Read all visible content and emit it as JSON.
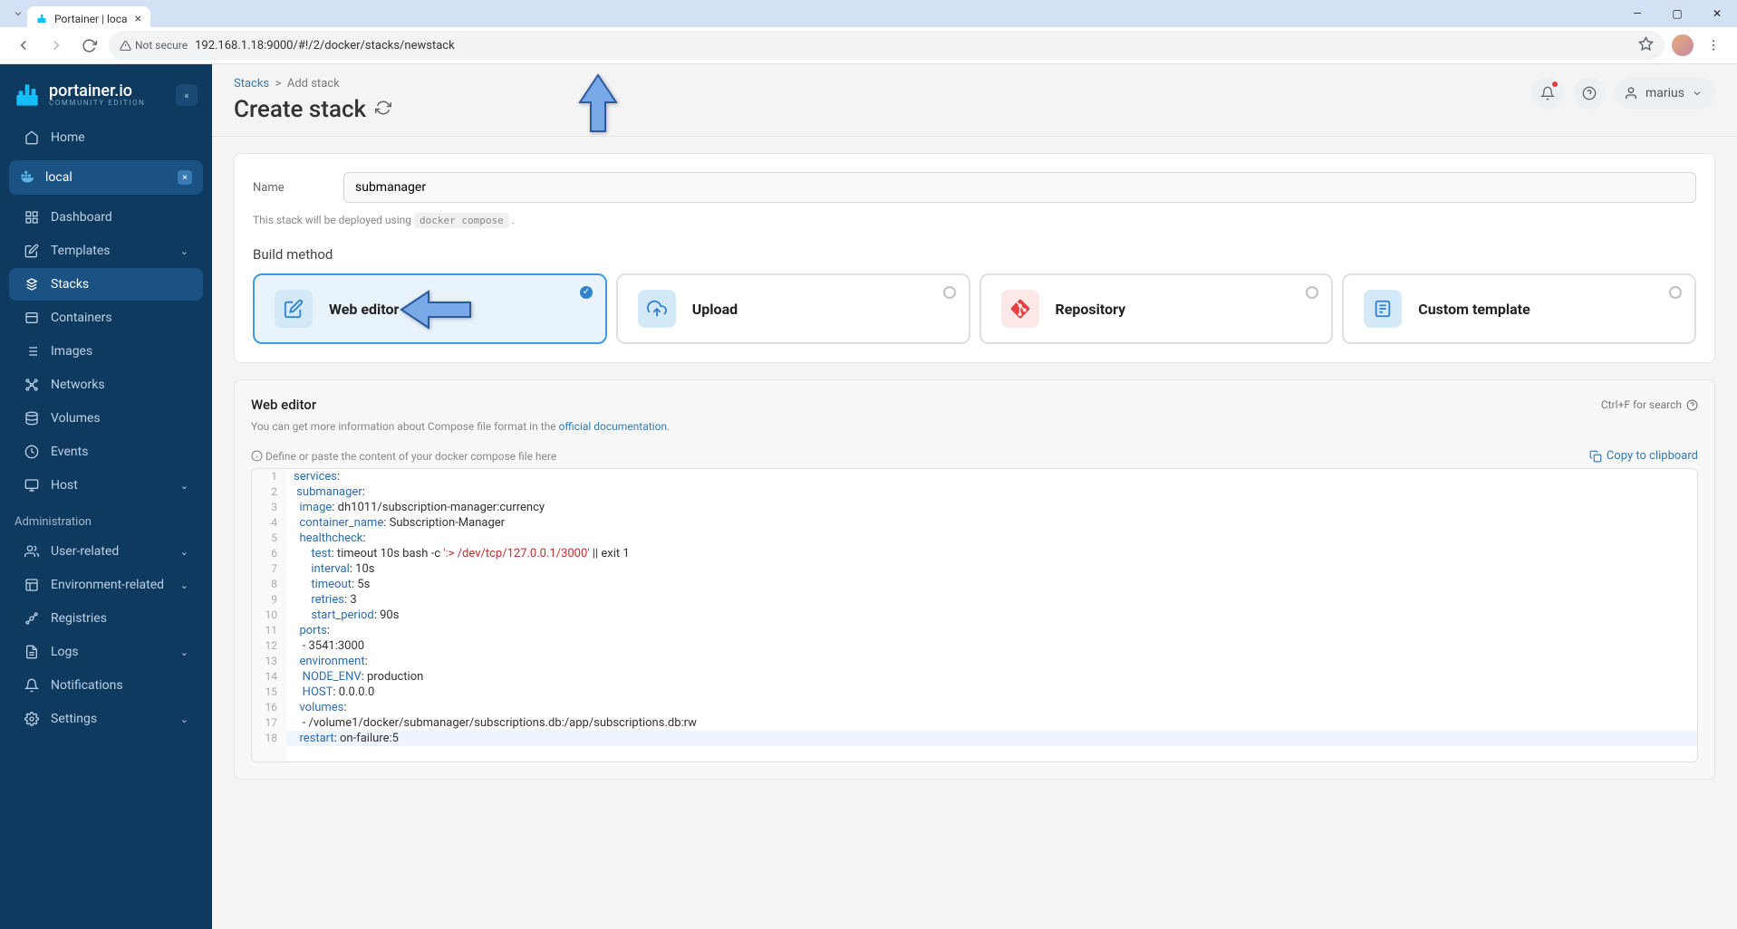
{
  "browser": {
    "tab_title": "Portainer | loca",
    "url": "192.168.1.18:9000/#!/2/docker/stacks/newstack",
    "security_label": "Not secure"
  },
  "brand": {
    "name": "portainer.io",
    "edition": "COMMUNITY EDITION"
  },
  "sidebar": {
    "home": "Home",
    "env_name": "local",
    "items": [
      {
        "label": "Dashboard",
        "icon": "dashboard"
      },
      {
        "label": "Templates",
        "icon": "templates",
        "chev": true
      },
      {
        "label": "Stacks",
        "icon": "stacks",
        "active": true
      },
      {
        "label": "Containers",
        "icon": "containers"
      },
      {
        "label": "Images",
        "icon": "images"
      },
      {
        "label": "Networks",
        "icon": "networks"
      },
      {
        "label": "Volumes",
        "icon": "volumes"
      },
      {
        "label": "Events",
        "icon": "events"
      },
      {
        "label": "Host",
        "icon": "host",
        "chev": true
      }
    ],
    "admin_header": "Administration",
    "admin_items": [
      {
        "label": "User-related",
        "chev": true
      },
      {
        "label": "Environment-related",
        "chev": true
      },
      {
        "label": "Registries"
      },
      {
        "label": "Logs",
        "chev": true
      },
      {
        "label": "Notifications"
      },
      {
        "label": "Settings",
        "chev": true
      }
    ]
  },
  "header": {
    "breadcrumb_root": "Stacks",
    "breadcrumb_leaf": "Add stack",
    "title": "Create stack",
    "user": "marius"
  },
  "form": {
    "name_label": "Name",
    "name_value": "submanager",
    "deploy_note_prefix": "This stack will be deployed using ",
    "deploy_note_cmd": "docker compose",
    "build_method_label": "Build method",
    "methods": [
      {
        "title": "Web editor"
      },
      {
        "title": "Upload"
      },
      {
        "title": "Repository"
      },
      {
        "title": "Custom template"
      }
    ]
  },
  "editor": {
    "title": "Web editor",
    "search_hint": "Ctrl+F for search",
    "info_text_prefix": "You can get more information about Compose file format in the ",
    "info_link": "official documentation",
    "placeholder_hint": "Define or paste the content of your docker compose file here",
    "copy_label": "Copy to clipboard",
    "lines": [
      [
        {
          "t": "services",
          "c": "k"
        },
        {
          "t": ":",
          "c": "p"
        }
      ],
      [
        {
          "t": " submanager",
          "c": "k"
        },
        {
          "t": ":",
          "c": "p"
        }
      ],
      [
        {
          "t": "  image",
          "c": "k"
        },
        {
          "t": ": dh1011/subscription-manager:currency",
          "c": "p"
        }
      ],
      [
        {
          "t": "  container_name",
          "c": "k"
        },
        {
          "t": ": Subscription-Manager",
          "c": "p"
        }
      ],
      [
        {
          "t": "  healthcheck",
          "c": "k"
        },
        {
          "t": ":",
          "c": "p"
        }
      ],
      [
        {
          "t": "      test",
          "c": "k"
        },
        {
          "t": ": timeout 10s bash -c ",
          "c": "p"
        },
        {
          "t": "':> /dev/tcp/127.0.0.1/3000'",
          "c": "s"
        },
        {
          "t": " || exit 1",
          "c": "p"
        }
      ],
      [
        {
          "t": "      interval",
          "c": "k"
        },
        {
          "t": ": 10s",
          "c": "p"
        }
      ],
      [
        {
          "t": "      timeout",
          "c": "k"
        },
        {
          "t": ": 5s",
          "c": "p"
        }
      ],
      [
        {
          "t": "      retries",
          "c": "k"
        },
        {
          "t": ": 3",
          "c": "p"
        }
      ],
      [
        {
          "t": "      start_period",
          "c": "k"
        },
        {
          "t": ": 90s",
          "c": "p"
        }
      ],
      [
        {
          "t": "  ports",
          "c": "k"
        },
        {
          "t": ":",
          "c": "p"
        }
      ],
      [
        {
          "t": "   - 3541:3000",
          "c": "p"
        }
      ],
      [
        {
          "t": "  environment",
          "c": "k"
        },
        {
          "t": ":",
          "c": "p"
        }
      ],
      [
        {
          "t": "   NODE_ENV",
          "c": "k"
        },
        {
          "t": ": production",
          "c": "p"
        }
      ],
      [
        {
          "t": "   HOST",
          "c": "k"
        },
        {
          "t": ": 0.0.0.0",
          "c": "p"
        }
      ],
      [
        {
          "t": "  volumes",
          "c": "k"
        },
        {
          "t": ":",
          "c": "p"
        }
      ],
      [
        {
          "t": "   - /volume1/docker/submanager/subscriptions.db:/app/subscriptions.db:rw",
          "c": "p"
        }
      ],
      [
        {
          "t": "  restart",
          "c": "k"
        },
        {
          "t": ": on-failure:5",
          "c": "p"
        }
      ]
    ]
  }
}
